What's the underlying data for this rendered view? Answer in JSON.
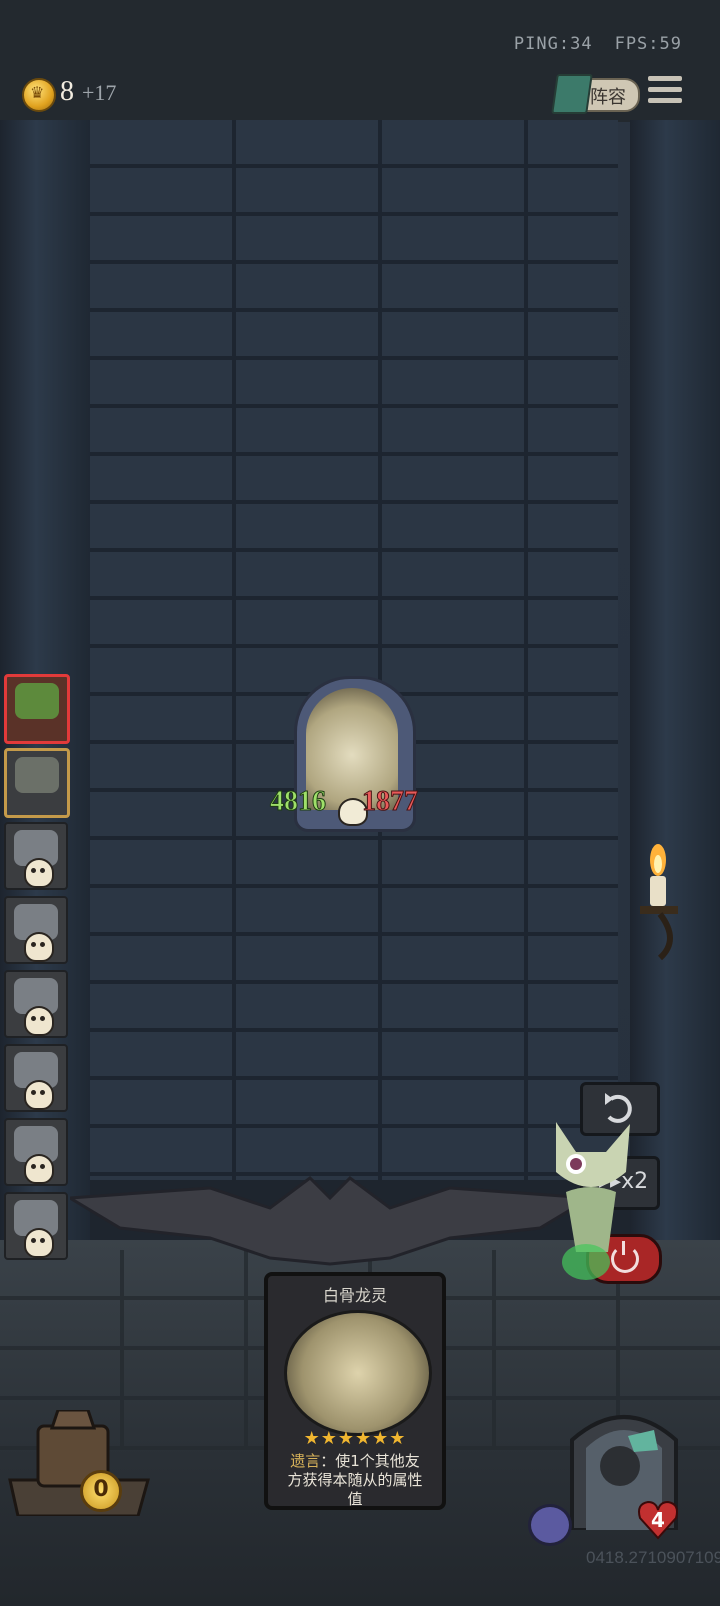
{
  "status": {
    "ping": "PING:34",
    "fps": "FPS:59"
  },
  "currency": {
    "gold": "8",
    "income": "+17",
    "icon": "crown-coin-icon"
  },
  "top_right": {
    "lineup_label": "阵容",
    "menu_icon": "menu-icon"
  },
  "enemy_unit": {
    "attack": "4816",
    "health": "1877",
    "portrait": "bone-dragon-portrait"
  },
  "controls": {
    "undo_icon": "undo-icon",
    "speed_label": "▸▸x2",
    "power_icon": "power-icon"
  },
  "card": {
    "title": "白骨龙灵",
    "stars": "★★★★★★",
    "text_keyword": "遗言",
    "text_body": "：使1个其他友方获得本随从的属性值"
  },
  "shop": {
    "gold": "0"
  },
  "hero": {
    "health": "4"
  },
  "build_id": "0418.2710907109",
  "colors": {
    "attack": "#9fe06a",
    "health": "#ea5a5a",
    "accent_red": "#e23a3a",
    "gold": "#f0b630"
  }
}
